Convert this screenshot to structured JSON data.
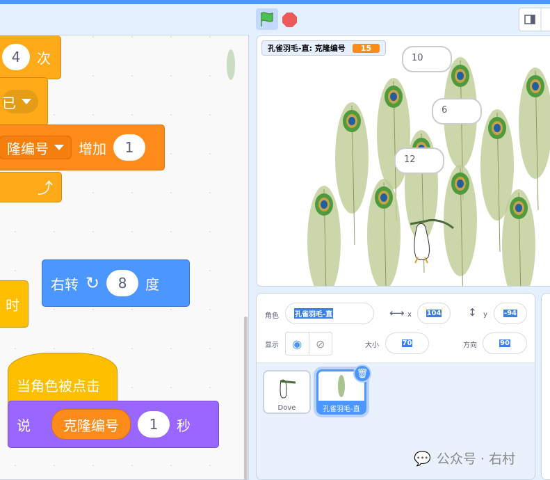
{
  "code": {
    "repeat_count": "4",
    "repeat_suffix": "次",
    "stop_partial": "已",
    "var_name": "隆编号",
    "change_label": "增加",
    "change_value": "1",
    "turn_label": "右转",
    "turn_value": "8",
    "turn_unit": "度",
    "hat_partial": "时",
    "when_clicked": "当角色被点击",
    "say_label": "说",
    "say_var": "克隆编号",
    "say_secs": "1",
    "say_unit": "秒"
  },
  "stage": {
    "monitor_label": "孔雀羽毛-直: 克隆编号",
    "monitor_value": "15",
    "bubbles": [
      "10",
      "6",
      "12"
    ]
  },
  "sprite_info": {
    "sprite_label": "角色",
    "sprite_name": "孔雀羽毛-直",
    "x_label": "x",
    "x": "104",
    "y_label": "y",
    "y": "-94",
    "show_label": "显示",
    "size_label": "大小",
    "size": "70",
    "direction_label": "方向",
    "direction": "90"
  },
  "sprites": [
    {
      "name": "Dove"
    },
    {
      "name": "孔雀羽毛-直"
    }
  ],
  "watermark": "公众号 · 右村",
  "colors": {
    "accent": "#4c97ff",
    "control": "#ffab19",
    "variable": "#ff8c1a",
    "motion": "#4c97ff",
    "looks": "#9966ff"
  }
}
